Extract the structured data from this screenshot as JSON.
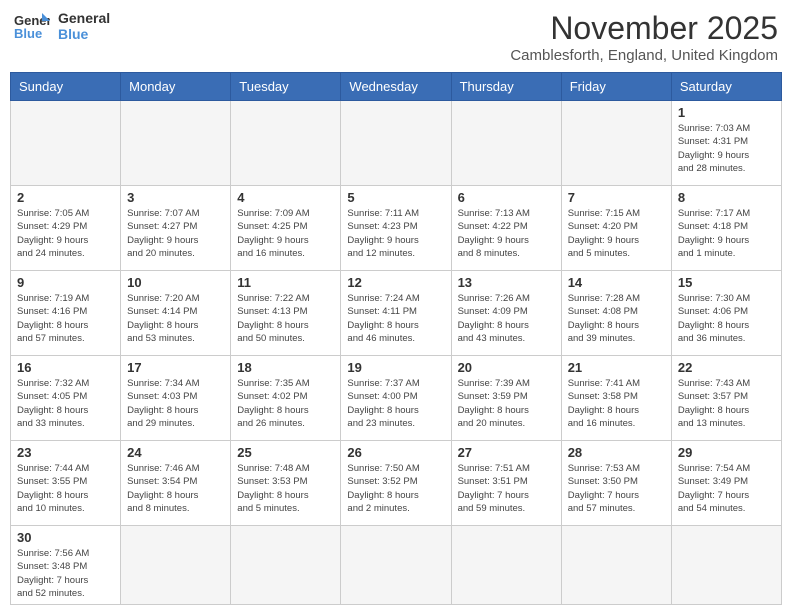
{
  "logo": {
    "line1": "General",
    "line2": "Blue"
  },
  "title": "November 2025",
  "location": "Camblesforth, England, United Kingdom",
  "days_of_week": [
    "Sunday",
    "Monday",
    "Tuesday",
    "Wednesday",
    "Thursday",
    "Friday",
    "Saturday"
  ],
  "weeks": [
    [
      {
        "day": "",
        "info": ""
      },
      {
        "day": "",
        "info": ""
      },
      {
        "day": "",
        "info": ""
      },
      {
        "day": "",
        "info": ""
      },
      {
        "day": "",
        "info": ""
      },
      {
        "day": "",
        "info": ""
      },
      {
        "day": "1",
        "info": "Sunrise: 7:03 AM\nSunset: 4:31 PM\nDaylight: 9 hours\nand 28 minutes."
      }
    ],
    [
      {
        "day": "2",
        "info": "Sunrise: 7:05 AM\nSunset: 4:29 PM\nDaylight: 9 hours\nand 24 minutes."
      },
      {
        "day": "3",
        "info": "Sunrise: 7:07 AM\nSunset: 4:27 PM\nDaylight: 9 hours\nand 20 minutes."
      },
      {
        "day": "4",
        "info": "Sunrise: 7:09 AM\nSunset: 4:25 PM\nDaylight: 9 hours\nand 16 minutes."
      },
      {
        "day": "5",
        "info": "Sunrise: 7:11 AM\nSunset: 4:23 PM\nDaylight: 9 hours\nand 12 minutes."
      },
      {
        "day": "6",
        "info": "Sunrise: 7:13 AM\nSunset: 4:22 PM\nDaylight: 9 hours\nand 8 minutes."
      },
      {
        "day": "7",
        "info": "Sunrise: 7:15 AM\nSunset: 4:20 PM\nDaylight: 9 hours\nand 5 minutes."
      },
      {
        "day": "8",
        "info": "Sunrise: 7:17 AM\nSunset: 4:18 PM\nDaylight: 9 hours\nand 1 minute."
      }
    ],
    [
      {
        "day": "9",
        "info": "Sunrise: 7:19 AM\nSunset: 4:16 PM\nDaylight: 8 hours\nand 57 minutes."
      },
      {
        "day": "10",
        "info": "Sunrise: 7:20 AM\nSunset: 4:14 PM\nDaylight: 8 hours\nand 53 minutes."
      },
      {
        "day": "11",
        "info": "Sunrise: 7:22 AM\nSunset: 4:13 PM\nDaylight: 8 hours\nand 50 minutes."
      },
      {
        "day": "12",
        "info": "Sunrise: 7:24 AM\nSunset: 4:11 PM\nDaylight: 8 hours\nand 46 minutes."
      },
      {
        "day": "13",
        "info": "Sunrise: 7:26 AM\nSunset: 4:09 PM\nDaylight: 8 hours\nand 43 minutes."
      },
      {
        "day": "14",
        "info": "Sunrise: 7:28 AM\nSunset: 4:08 PM\nDaylight: 8 hours\nand 39 minutes."
      },
      {
        "day": "15",
        "info": "Sunrise: 7:30 AM\nSunset: 4:06 PM\nDaylight: 8 hours\nand 36 minutes."
      }
    ],
    [
      {
        "day": "16",
        "info": "Sunrise: 7:32 AM\nSunset: 4:05 PM\nDaylight: 8 hours\nand 33 minutes."
      },
      {
        "day": "17",
        "info": "Sunrise: 7:34 AM\nSunset: 4:03 PM\nDaylight: 8 hours\nand 29 minutes."
      },
      {
        "day": "18",
        "info": "Sunrise: 7:35 AM\nSunset: 4:02 PM\nDaylight: 8 hours\nand 26 minutes."
      },
      {
        "day": "19",
        "info": "Sunrise: 7:37 AM\nSunset: 4:00 PM\nDaylight: 8 hours\nand 23 minutes."
      },
      {
        "day": "20",
        "info": "Sunrise: 7:39 AM\nSunset: 3:59 PM\nDaylight: 8 hours\nand 20 minutes."
      },
      {
        "day": "21",
        "info": "Sunrise: 7:41 AM\nSunset: 3:58 PM\nDaylight: 8 hours\nand 16 minutes."
      },
      {
        "day": "22",
        "info": "Sunrise: 7:43 AM\nSunset: 3:57 PM\nDaylight: 8 hours\nand 13 minutes."
      }
    ],
    [
      {
        "day": "23",
        "info": "Sunrise: 7:44 AM\nSunset: 3:55 PM\nDaylight: 8 hours\nand 10 minutes."
      },
      {
        "day": "24",
        "info": "Sunrise: 7:46 AM\nSunset: 3:54 PM\nDaylight: 8 hours\nand 8 minutes."
      },
      {
        "day": "25",
        "info": "Sunrise: 7:48 AM\nSunset: 3:53 PM\nDaylight: 8 hours\nand 5 minutes."
      },
      {
        "day": "26",
        "info": "Sunrise: 7:50 AM\nSunset: 3:52 PM\nDaylight: 8 hours\nand 2 minutes."
      },
      {
        "day": "27",
        "info": "Sunrise: 7:51 AM\nSunset: 3:51 PM\nDaylight: 7 hours\nand 59 minutes."
      },
      {
        "day": "28",
        "info": "Sunrise: 7:53 AM\nSunset: 3:50 PM\nDaylight: 7 hours\nand 57 minutes."
      },
      {
        "day": "29",
        "info": "Sunrise: 7:54 AM\nSunset: 3:49 PM\nDaylight: 7 hours\nand 54 minutes."
      }
    ],
    [
      {
        "day": "30",
        "info": "Sunrise: 7:56 AM\nSunset: 3:48 PM\nDaylight: 7 hours\nand 52 minutes."
      },
      {
        "day": "",
        "info": ""
      },
      {
        "day": "",
        "info": ""
      },
      {
        "day": "",
        "info": ""
      },
      {
        "day": "",
        "info": ""
      },
      {
        "day": "",
        "info": ""
      },
      {
        "day": "",
        "info": ""
      }
    ]
  ]
}
